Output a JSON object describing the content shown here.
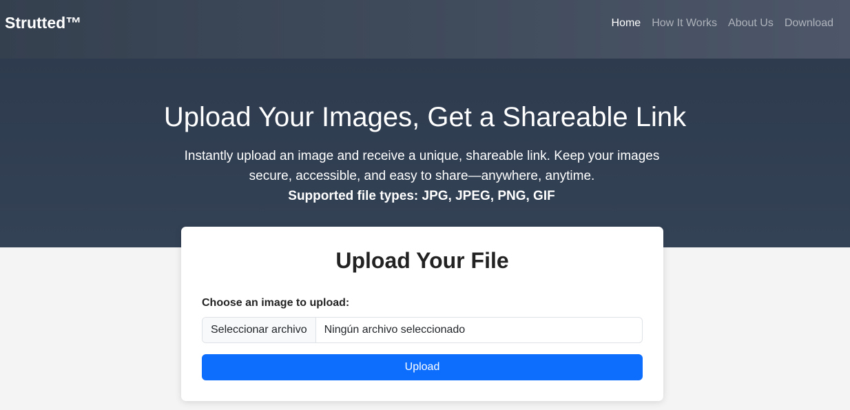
{
  "navbar": {
    "brand": "Strutted™",
    "links": [
      {
        "label": "Home",
        "active": true
      },
      {
        "label": "How It Works",
        "active": false
      },
      {
        "label": "About Us",
        "active": false
      },
      {
        "label": "Download",
        "active": false
      }
    ]
  },
  "hero": {
    "title": "Upload Your Images, Get a Shareable Link",
    "description": "Instantly upload an image and receive a unique, shareable link. Keep your images secure, accessible, and easy to share—anywhere, anytime.",
    "supported_types": "Supported file types: JPG, JPEG, PNG, GIF"
  },
  "upload_card": {
    "title": "Upload Your File",
    "label": "Choose an image to upload:",
    "file_button": "Seleccionar archivo",
    "file_status": "Ningún archivo seleccionado",
    "submit_label": "Upload"
  },
  "colors": {
    "primary": "#0d6efd",
    "hero_bg": "#2e3b4e",
    "navbar_bg": "#3f4a5b",
    "page_bg": "#f4f4f4"
  }
}
